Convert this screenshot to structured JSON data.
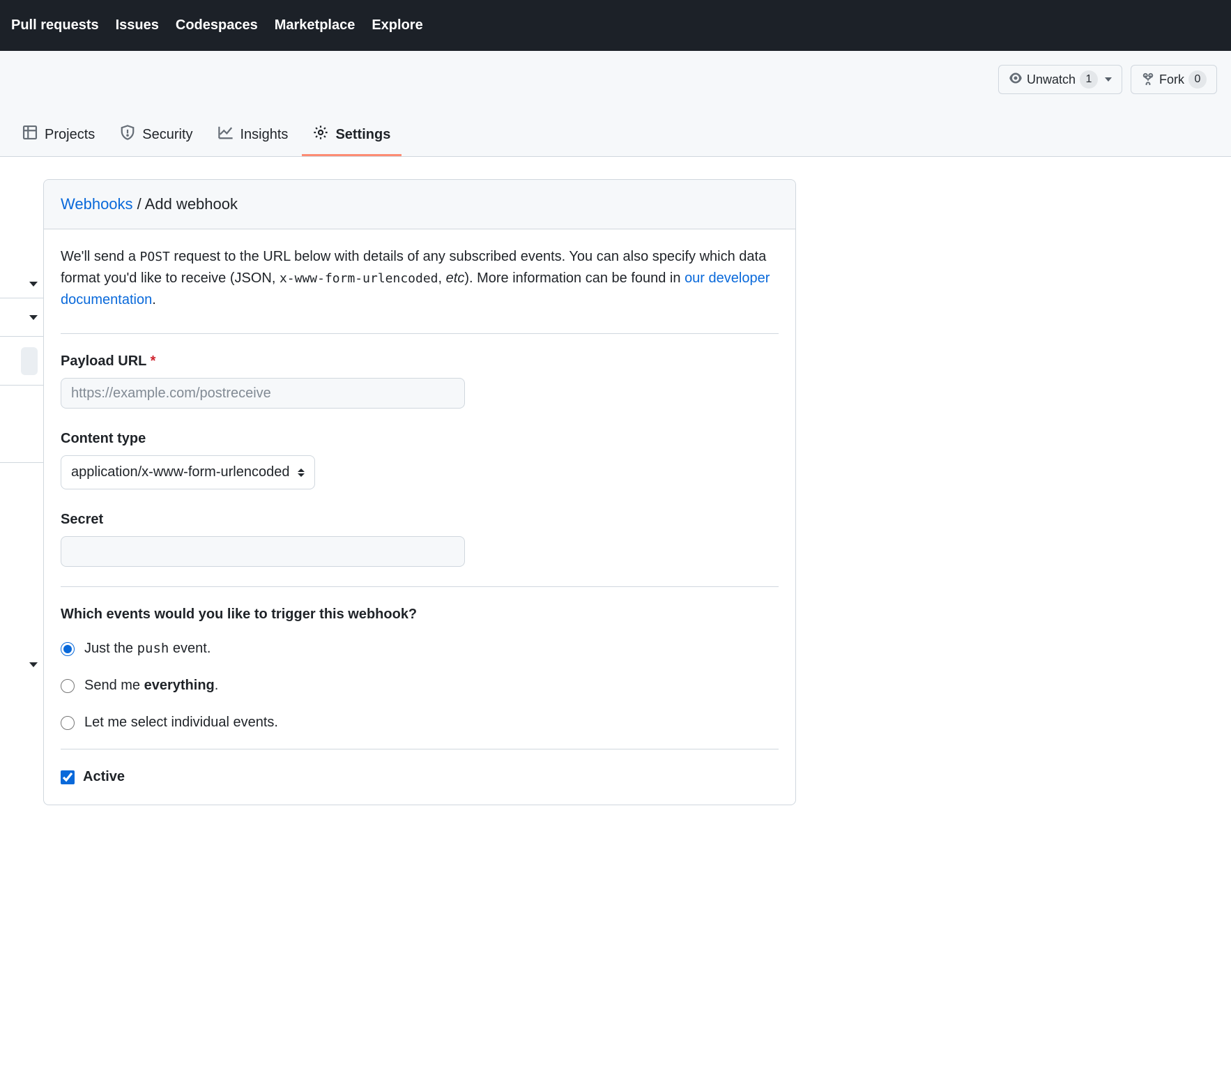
{
  "top_nav": {
    "pull_requests": "Pull requests",
    "issues": "Issues",
    "codespaces": "Codespaces",
    "marketplace": "Marketplace",
    "explore": "Explore"
  },
  "repo_actions": {
    "unwatch_label": "Unwatch",
    "unwatch_count": "1",
    "fork_label": "Fork",
    "fork_count": "0"
  },
  "repo_tabs": {
    "projects": "Projects",
    "security": "Security",
    "insights": "Insights",
    "settings": "Settings"
  },
  "breadcrumb": {
    "webhooks": "Webhooks",
    "slash": " / ",
    "current": "Add webhook"
  },
  "intro": {
    "part1": "We'll send a ",
    "post": "POST",
    "part2": " request to the URL below with details of any subscribed events. You can also specify which data format you'd like to receive (JSON, ",
    "code": "x-www-form-urlencoded",
    "part3": ", ",
    "etc": "etc",
    "part4": "). More information can be found in ",
    "link": "our developer documentation",
    "part5": "."
  },
  "form": {
    "payload_label": "Payload URL",
    "payload_placeholder": "https://example.com/postreceive",
    "content_type_label": "Content type",
    "content_type_value": "application/x-www-form-urlencoded",
    "secret_label": "Secret",
    "events_heading": "Which events would you like to trigger this webhook?",
    "radio_just_push_pre": "Just the ",
    "radio_just_push_code": "push",
    "radio_just_push_post": " event.",
    "radio_everything_pre": "Send me ",
    "radio_everything_bold": "everything",
    "radio_everything_post": ".",
    "radio_individual": "Let me select individual events.",
    "active_label": "Active"
  }
}
